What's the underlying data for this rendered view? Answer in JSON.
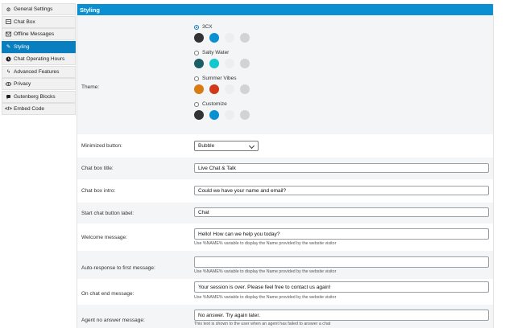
{
  "sidebar": {
    "items": [
      {
        "label": "General Settings",
        "icon": "gear-icon"
      },
      {
        "label": "Chat Box",
        "icon": "chatbox-icon"
      },
      {
        "label": "Offline Messages",
        "icon": "envelope-icon"
      },
      {
        "label": "Styling",
        "icon": "pencil-icon"
      },
      {
        "label": "Chat Operating Hours",
        "icon": "clock-icon"
      },
      {
        "label": "Advanced Features",
        "icon": "bolt-icon"
      },
      {
        "label": "Privacy",
        "icon": "eye-icon"
      },
      {
        "label": "Gutenberg Blocks",
        "icon": "blocks-icon"
      },
      {
        "label": "Embed Code",
        "icon": "code-icon"
      }
    ],
    "active_index": 3
  },
  "panel": {
    "title": "Styling",
    "theme": {
      "label": "Theme:",
      "options": [
        {
          "name": "3CX",
          "checked": true,
          "colors": [
            "#333333",
            "#0a8fd0",
            "#eeeeee",
            "#d3d3d3"
          ]
        },
        {
          "name": "Salty Water",
          "checked": false,
          "colors": [
            "#1b5e66",
            "#13c7cc",
            "#eeeeee",
            "#d3d3d3"
          ]
        },
        {
          "name": "Summer Vibes",
          "checked": false,
          "colors": [
            "#d97a12",
            "#d0391a",
            "#eeeeee",
            "#d3d3d3"
          ]
        },
        {
          "name": "Customize",
          "checked": false,
          "colors": [
            "#333333",
            "#0a8fd0",
            "#eeeeee",
            "#d3d3d3"
          ]
        }
      ]
    },
    "minimized": {
      "label": "Minimized button:",
      "value": "Bubble"
    },
    "fields": [
      {
        "label": "Chat box title:",
        "value": "Live Chat & Talk",
        "hint": ""
      },
      {
        "label": "Chat box intro:",
        "value": "Could we have your name and email?",
        "hint": ""
      },
      {
        "label": "Start chat button label:",
        "value": "Chat",
        "hint": ""
      },
      {
        "label": "Welcome message:",
        "value": "Hello! How can we help you today?",
        "hint": "Use %NAME% variable to display the Name provided by the website visitor"
      },
      {
        "label": "Auto-response to first message:",
        "value": "",
        "hint": "Use %NAME% variable to display the Name provided by the website visitor"
      },
      {
        "label": "On chat end message:",
        "value": "Your session is over. Please feel free to contact us again!",
        "hint": "Use %NAME% variable to display the Name provided by the website visitor"
      },
      {
        "label": "Agent no answer message:",
        "value": "No answer. Try again later.",
        "hint": "This text is shown to the user when an agent has failed to answer a chat"
      }
    ]
  },
  "colors": {
    "accent": "#0a8fd0",
    "active_tab": "#0a7fc0",
    "row_alt": "#f4f5f6"
  }
}
